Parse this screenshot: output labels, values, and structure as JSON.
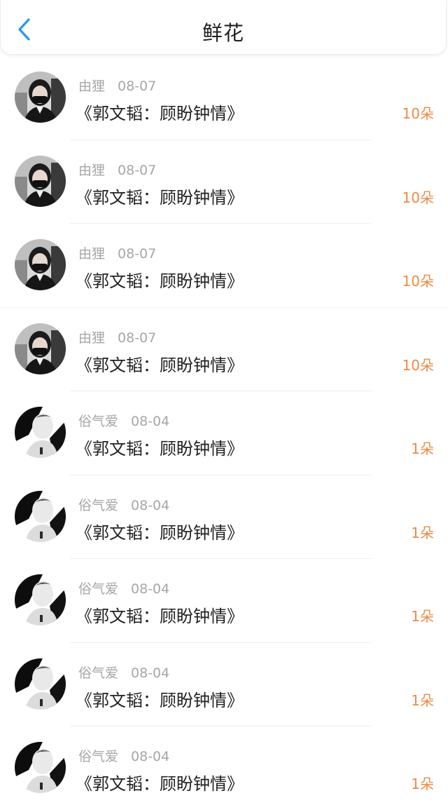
{
  "header": {
    "title": "鲜花",
    "back_icon": "chevron-left-icon",
    "accent_color": "#2f97e8"
  },
  "list": {
    "count_color": "#ee8a44",
    "items": [
      {
        "user": "由狸",
        "date": "08-07",
        "book": "《郭文韬：顾盼钟情》",
        "count": "10朵",
        "avatar": "avatar-woman-mask"
      },
      {
        "user": "由狸",
        "date": "08-07",
        "book": "《郭文韬：顾盼钟情》",
        "count": "10朵",
        "avatar": "avatar-woman-mask"
      },
      {
        "user": "由狸",
        "date": "08-07",
        "book": "《郭文韬：顾盼钟情》",
        "count": "10朵",
        "avatar": "avatar-woman-mask"
      },
      {
        "user": "由狸",
        "date": "08-07",
        "book": "《郭文韬：顾盼钟情》",
        "count": "10朵",
        "avatar": "avatar-woman-mask"
      },
      {
        "user": "俗气爱",
        "date": "08-04",
        "book": "《郭文韬：顾盼钟情》",
        "count": "1朵",
        "avatar": "avatar-bw-portrait"
      },
      {
        "user": "俗气爱",
        "date": "08-04",
        "book": "《郭文韬：顾盼钟情》",
        "count": "1朵",
        "avatar": "avatar-bw-portrait"
      },
      {
        "user": "俗气爱",
        "date": "08-04",
        "book": "《郭文韬：顾盼钟情》",
        "count": "1朵",
        "avatar": "avatar-bw-portrait"
      },
      {
        "user": "俗气爱",
        "date": "08-04",
        "book": "《郭文韬：顾盼钟情》",
        "count": "1朵",
        "avatar": "avatar-bw-portrait"
      },
      {
        "user": "俗气爱",
        "date": "08-04",
        "book": "《郭文韬：顾盼钟情》",
        "count": "1朵",
        "avatar": "avatar-bw-portrait"
      }
    ]
  }
}
